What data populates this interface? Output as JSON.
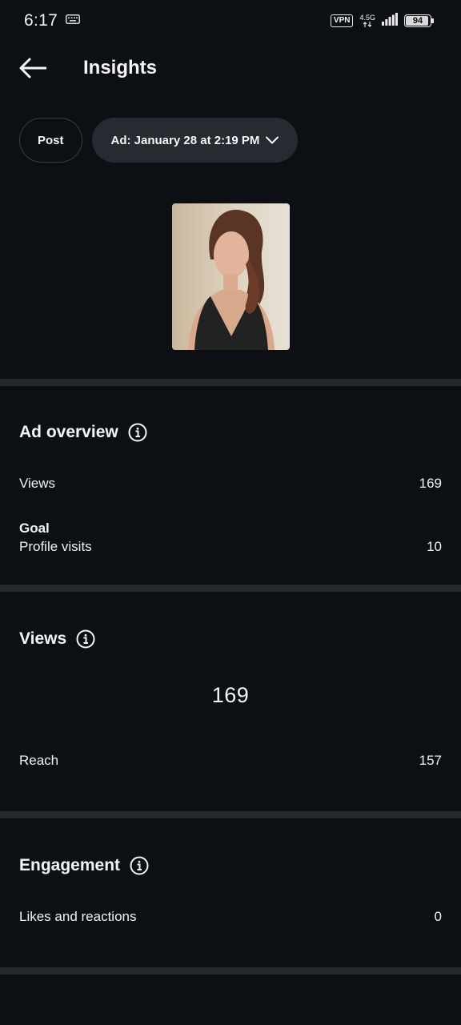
{
  "status_bar": {
    "time": "6:17",
    "vpn": "VPN",
    "network": "4.5G",
    "battery": "94",
    "battery_level": 0.94
  },
  "header": {
    "title": "Insights",
    "back_icon": "arrow-left-icon"
  },
  "chips": {
    "post_label": "Post",
    "ad_label": "Ad: January 28 at 2:19 PM"
  },
  "ad_overview": {
    "title": "Ad overview",
    "views_label": "Views",
    "views_value": "169",
    "goal_label": "Goal",
    "profile_visits_label": "Profile visits",
    "profile_visits_value": "10"
  },
  "views_section": {
    "title": "Views",
    "total": "169",
    "reach_label": "Reach",
    "reach_value": "157"
  },
  "engagement": {
    "title": "Engagement",
    "likes_label": "Likes and reactions",
    "likes_value": "0"
  },
  "colors": {
    "background": "#0c1014",
    "divider": "#25292e",
    "chip_fill": "#262a31",
    "text": "#f5f5f5"
  }
}
